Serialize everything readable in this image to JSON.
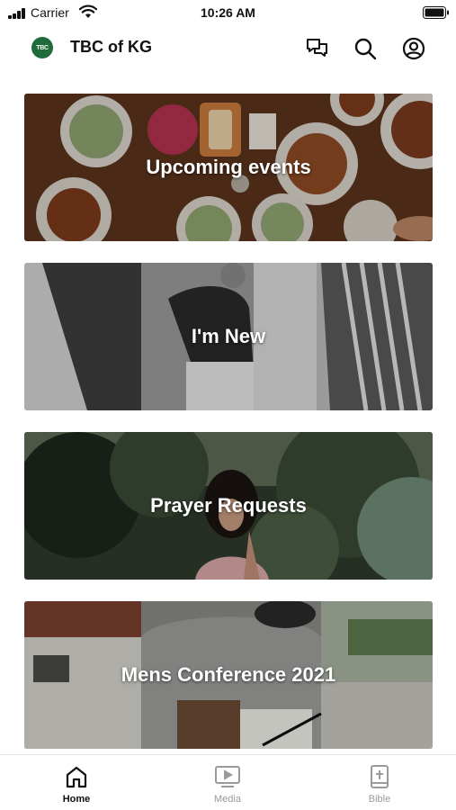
{
  "status_bar": {
    "carrier": "Carrier",
    "time": "10:26 AM"
  },
  "header": {
    "logo_text": "TBC",
    "title": "TBC of KG",
    "icons": [
      "chat-icon",
      "search-icon",
      "account-icon"
    ]
  },
  "cards": [
    {
      "label": "Upcoming events",
      "theme": "food-table"
    },
    {
      "label": "I'm New",
      "theme": "holding-hands"
    },
    {
      "label": "Prayer Requests",
      "theme": "praying-woman"
    },
    {
      "label": "Mens Conference 2021",
      "theme": "man-writing"
    }
  ],
  "tab_bar": {
    "tabs": [
      {
        "label": "Home",
        "icon": "home-icon",
        "active": true
      },
      {
        "label": "Media",
        "icon": "media-icon",
        "active": false
      },
      {
        "label": "Bible",
        "icon": "bible-icon",
        "active": false
      }
    ]
  },
  "colors": {
    "brand_green": "#1f6b3a",
    "active_tab": "#111111",
    "inactive_tab": "#9a9a9a"
  }
}
